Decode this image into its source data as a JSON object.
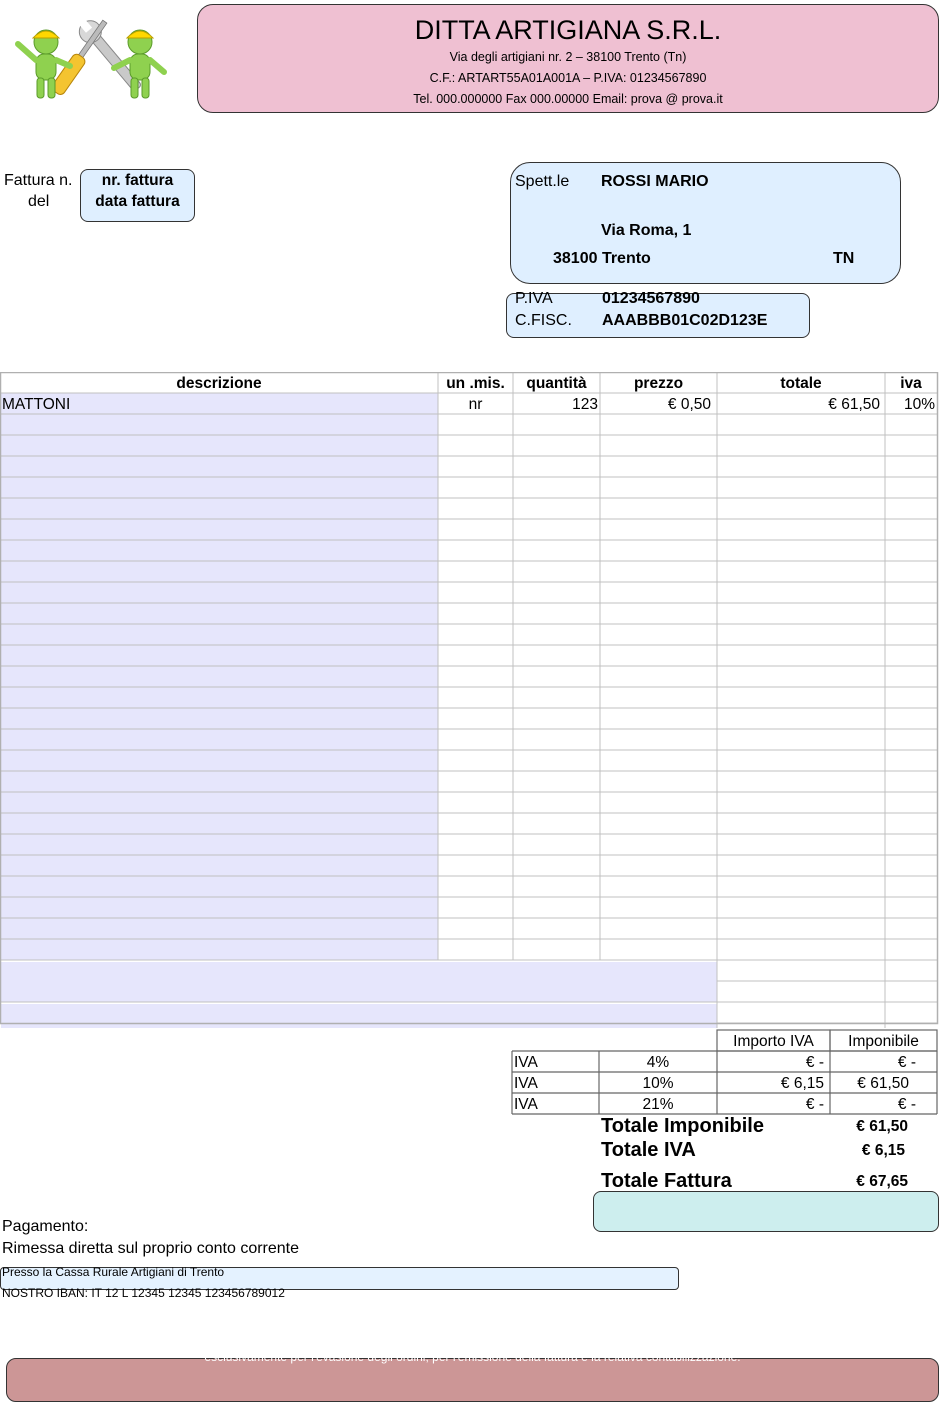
{
  "company": {
    "name": "DITTA ARTIGIANA S.R.L.",
    "address": "Via degli artigiani nr. 2 – 38100 Trento (Tn)",
    "fiscal": "C.F.: ARTART55A01A001A – P.IVA: 01234567890",
    "contacts": "Tel. 000.000000 Fax 000.00000 Email: prova @ prova.it",
    "header_color": "#efc0d2"
  },
  "invoice": {
    "number_label": "Fattura n.",
    "date_label": "del",
    "number_value": "nr. fattura",
    "date_value": "data fattura"
  },
  "customer": {
    "salutation": "Spett.le",
    "name": "ROSSI MARIO",
    "street": "Via Roma, 1",
    "city": "38100 Trento",
    "province": "TN",
    "piva_label": "P.IVA",
    "piva_value": "01234567890",
    "cf_label": "C.FISC.",
    "cf_value": "AAABBB01C02D123E"
  },
  "table": {
    "headers": [
      "descrizione",
      "un .mis.",
      "quantità",
      "prezzo",
      "totale",
      "iva"
    ],
    "rows": [
      {
        "descrizione": "MATTONI",
        "unita": "nr",
        "quantita": "123",
        "prezzo": "€ 0,50",
        "totale": "€ 61,50",
        "iva": "10%"
      }
    ],
    "description_fill": "#e6e6fc"
  },
  "vat_summary": {
    "headers": [
      "Importo IVA",
      "Imponibile"
    ],
    "rows": [
      {
        "label": "IVA",
        "rate": "4%",
        "importo": "€ -",
        "imponibile": "€ -"
      },
      {
        "label": "IVA",
        "rate": "10%",
        "importo": "€ 6,15",
        "imponibile": "€ 61,50"
      },
      {
        "label": "IVA",
        "rate": "21%",
        "importo": "€ -",
        "imponibile": "€ -"
      }
    ]
  },
  "totals": {
    "imponibile_label": "Totale Imponibile",
    "imponibile_value": "€ 61,50",
    "iva_label": "Totale IVA",
    "iva_value": "€ 6,15",
    "fattura_label": "Totale Fattura",
    "fattura_value": "€ 67,65"
  },
  "payment": {
    "title": "Pagamento:",
    "method": "Rimessa diretta sul proprio conto corrente",
    "bank": "Presso la Cassa Rurale Artigiani di Trento",
    "iban": "NOSTRO IBAN:  IT 12 L 12345 12345 123456789012"
  },
  "footer": {
    "note": "esclusivamente per l'evasione degli ordini, per l'emissione della fattura e la relativa contabilizzazione."
  }
}
